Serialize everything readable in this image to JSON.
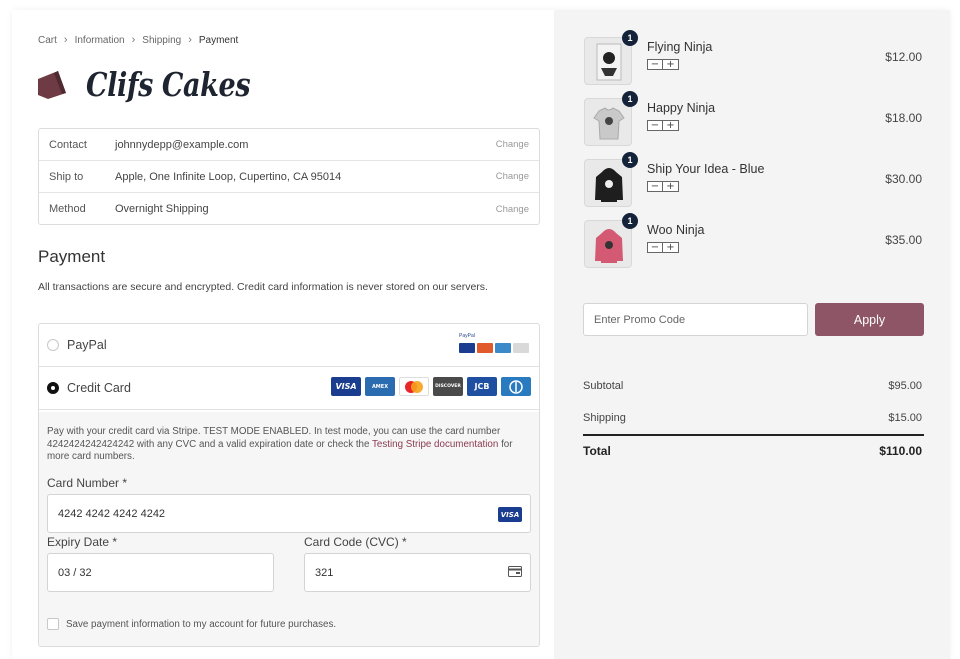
{
  "breadcrumb": {
    "items": [
      "Cart",
      "Information",
      "Shipping",
      "Payment"
    ]
  },
  "brand": {
    "name": "Clifs Cakes",
    "logo_color": "#6e3b44"
  },
  "info": [
    {
      "key": "Contact",
      "value": "johnnydepp@example.com",
      "action": "Change"
    },
    {
      "key": "Ship to",
      "value": "Apple, One Infinite Loop, Cupertino, CA 95014",
      "action": "Change"
    },
    {
      "key": "Method",
      "value": "Overnight Shipping",
      "action": "Change"
    }
  ],
  "payment": {
    "title": "Payment",
    "subtitle": "All transactions are secure and encrypted. Credit card information is never stored on our servers.",
    "options": [
      {
        "label": "PayPal",
        "selected": false
      },
      {
        "label": "Credit Card",
        "selected": true
      }
    ],
    "paypal_mark": "PayPal",
    "card_brands": [
      {
        "name": "VISA",
        "color": "#1a3d8f"
      },
      {
        "name": "AMEX",
        "color": "#2b6cb0"
      },
      {
        "name": "mastercard",
        "color": "#ffffff"
      },
      {
        "name": "DISCOVER",
        "color": "#4a4a4a"
      },
      {
        "name": "JCB",
        "color": "#1f4fa0"
      },
      {
        "name": "Diners",
        "color": "#2a7ac0"
      }
    ],
    "note_pre": "Pay with your credit card via Stripe. TEST MODE ENABLED. In test mode, you can use the card number 4242424242424242 with any CVC and a valid expiration date or check the ",
    "note_link": "Testing Stripe documentation",
    "note_post": " for more card numbers.",
    "card_number_label": "Card Number *",
    "card_number_value": "4242 4242 4242 4242",
    "card_number_brand": "VISA",
    "expiry_label": "Expiry Date *",
    "expiry_value": "03 / 32",
    "cvc_label": "Card Code (CVC) *",
    "cvc_value": "321",
    "save_label": "Save payment information to my account for future purchases."
  },
  "cart": {
    "items": [
      {
        "name": "Flying Ninja",
        "qty": "1",
        "price": "$12.00",
        "icon": "poster-icon"
      },
      {
        "name": "Happy Ninja",
        "qty": "1",
        "price": "$18.00",
        "icon": "tshirt-icon"
      },
      {
        "name": "Ship Your Idea - Blue",
        "qty": "1",
        "price": "$30.00",
        "icon": "hoodie-icon"
      },
      {
        "name": "Woo Ninja",
        "qty": "1",
        "price": "$35.00",
        "icon": "hoodie-icon"
      }
    ],
    "qty_minus": "−",
    "qty_plus": "+",
    "promo_placeholder": "Enter Promo Code",
    "apply_label": "Apply",
    "apply_color": "#8d5565",
    "subtotal_label": "Subtotal",
    "subtotal_value": "$95.00",
    "shipping_label": "Shipping",
    "shipping_value": "$15.00",
    "total_label": "Total",
    "total_value": "$110.00"
  }
}
